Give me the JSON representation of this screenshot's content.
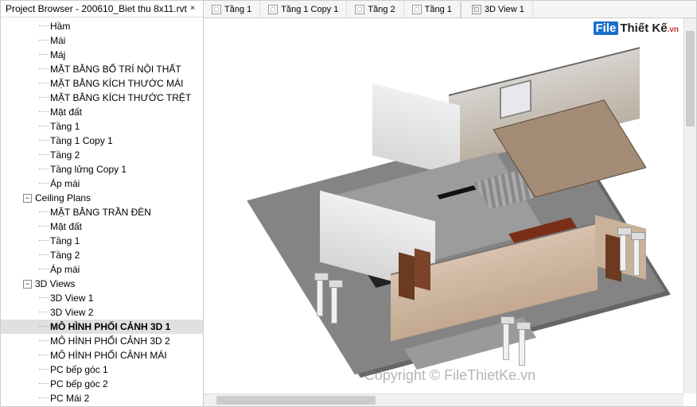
{
  "project_browser": {
    "title": "Project Browser - 200610_Biet thu 8x11.rvt",
    "close_icon": "×",
    "tree": [
      {
        "label": "Hầm",
        "level": 2
      },
      {
        "label": "Mái",
        "level": 2
      },
      {
        "label": "Máj",
        "level": 2
      },
      {
        "label": "MẶT BẰNG BỐ TRÍ NỘI THẤT",
        "level": 2
      },
      {
        "label": "MẶT BẰNG KÍCH THƯỚC MÁI",
        "level": 2
      },
      {
        "label": "MẶT BẰNG KÍCH THƯỚC TRỆT",
        "level": 2
      },
      {
        "label": "Mặt đất",
        "level": 2
      },
      {
        "label": "Tầng 1",
        "level": 2
      },
      {
        "label": "Tầng 1 Copy 1",
        "level": 2
      },
      {
        "label": "Tầng 2",
        "level": 2
      },
      {
        "label": "Tầng lửng Copy 1",
        "level": 2
      },
      {
        "label": "Áp mái",
        "level": 2
      },
      {
        "label": "Ceiling Plans",
        "level": 1,
        "toggle": "−"
      },
      {
        "label": "MẶT BẰNG TRẦN ĐÈN",
        "level": 2
      },
      {
        "label": "Mặt đất",
        "level": 2
      },
      {
        "label": "Tầng 1",
        "level": 2
      },
      {
        "label": "Tầng 2",
        "level": 2
      },
      {
        "label": "Áp mái",
        "level": 2
      },
      {
        "label": "3D Views",
        "level": 1,
        "toggle": "−"
      },
      {
        "label": "3D View 1",
        "level": 2
      },
      {
        "label": "3D View 2",
        "level": 2
      },
      {
        "label": "MÔ HÌNH PHỐI CẢNH 3D 1",
        "level": 2,
        "selected": true
      },
      {
        "label": "MÔ HÌNH PHỐI CẢNH 3D 2",
        "level": 2
      },
      {
        "label": "MÔ HÌNH PHỐI CẢNH MÁI",
        "level": 2
      },
      {
        "label": "PC bếp góc 1",
        "level": 2
      },
      {
        "label": "PC bếp góc 2",
        "level": 2
      },
      {
        "label": "PC Mái 2",
        "level": 2
      }
    ]
  },
  "tabs": [
    {
      "label": "Tầng 1",
      "type": "plan"
    },
    {
      "label": "Tầng 1 Copy 1",
      "type": "plan"
    },
    {
      "label": "Tầng 2",
      "type": "plan"
    },
    {
      "label": "Tầng 1",
      "type": "plan"
    },
    {
      "label": "3D View 1",
      "type": "3d"
    }
  ],
  "watermark": "Copyright © FileThietKe.vn",
  "logo": {
    "part1": "File",
    "part2": "Thiết Kế",
    "part3": ".vn"
  }
}
